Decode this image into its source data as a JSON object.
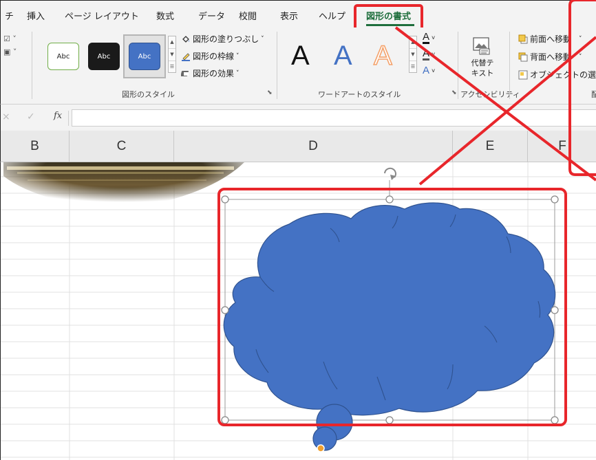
{
  "ribbon": {
    "tabs": [
      {
        "label": "チ"
      },
      {
        "label": "挿入"
      },
      {
        "label": "ページ レイアウト"
      },
      {
        "label": "数式"
      },
      {
        "label": "データ"
      },
      {
        "label": "校閲"
      },
      {
        "label": "表示"
      },
      {
        "label": "ヘルプ"
      },
      {
        "label": "図形の書式",
        "active": true
      }
    ],
    "shape_styles": {
      "presets": [
        {
          "label": "Abc",
          "style": "outline",
          "color": "#70ad47"
        },
        {
          "label": "Abc",
          "style": "dark",
          "color": "#1a1a1a"
        },
        {
          "label": "Abc",
          "style": "blue",
          "color": "#4472c4"
        }
      ],
      "fill_label": "図形の塗りつぶし",
      "outline_label": "図形の枠線",
      "effects_label": "図形の効果",
      "group_label": "図形のスタイル"
    },
    "wordart": {
      "letters": [
        {
          "char": "A",
          "style": "solid",
          "color": "#111111"
        },
        {
          "char": "A",
          "style": "blue",
          "color": "#4472c4"
        },
        {
          "char": "A",
          "style": "orange-outline",
          "color": "#f4a26b"
        }
      ],
      "small_letter": "A",
      "group_label": "ワードアートのスタイル"
    },
    "alt_text_label_line1": "代替テ",
    "alt_text_label_line2": "キスト",
    "accessibility_label": "アクセシビリティ",
    "arrange": {
      "bring_forward": "前面へ移動",
      "send_backward": "背面へ移動",
      "selection_pane": "オブジェクトの選択と",
      "group_label_fragment": "配"
    }
  },
  "formula_bar": {
    "cancel_glyph": "×",
    "enter_glyph": "✓",
    "fx_label": "fx",
    "value": ""
  },
  "columns": [
    "B",
    "C",
    "D",
    "E",
    "F"
  ],
  "shape": {
    "type": "cloud-callout",
    "fill": "#4472c4",
    "stroke": "#2f528f"
  },
  "colors": {
    "accent_green": "#1e6e3c",
    "highlight_red": "#e8262b",
    "shape_blue": "#4472c4",
    "adjust_handle": "#f0a030"
  }
}
